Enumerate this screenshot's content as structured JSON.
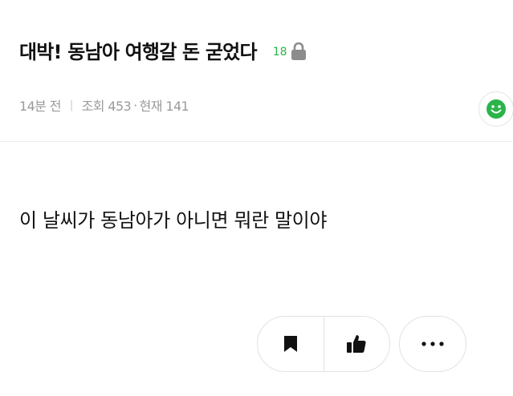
{
  "post": {
    "title": "대박! 동남아 여행갈 돈 굳었다",
    "comment_count": "18",
    "meta": {
      "time": "14분 전",
      "views": "조회 453",
      "current": "현재 141"
    },
    "body": "이 날씨가 동남아가 아니면 뭐란 말이야"
  },
  "icons": {
    "lock": "lock-icon",
    "emoji": "smiley-icon",
    "bookmark": "bookmark-icon",
    "like": "thumbs-up-icon",
    "more": "more-dots-icon"
  },
  "colors": {
    "accent_green": "#2bb44a",
    "meta_gray": "#9a9a9a"
  }
}
